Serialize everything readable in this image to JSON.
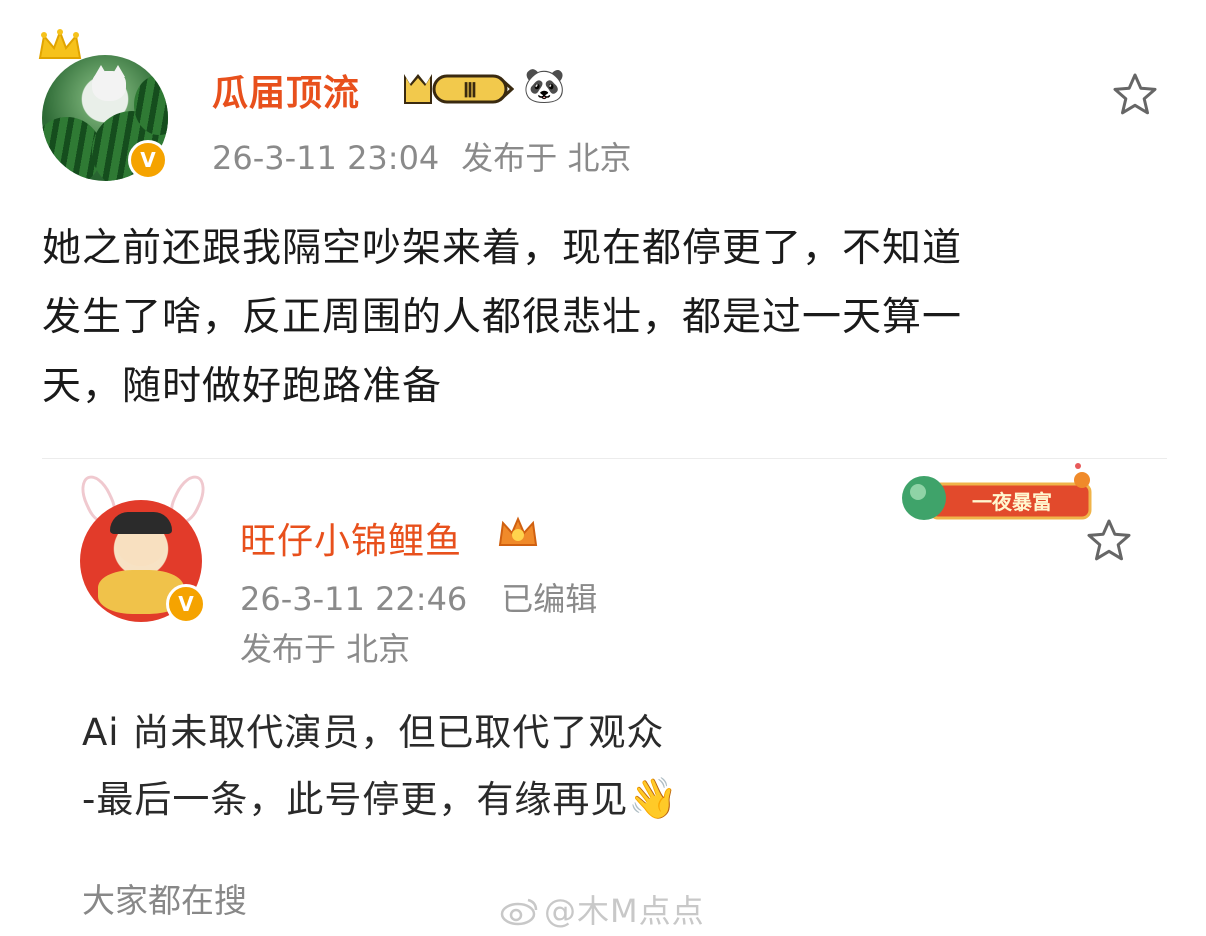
{
  "post": {
    "username": "瓜届顶流",
    "level_badge": "Ⅲ",
    "panda_emoji": "🐼",
    "timestamp": "26-3-11 23:04",
    "location": "发布于 北京",
    "text_line1": "她之前还跟我隔空吵架来着，现在都停更了，不知道",
    "text_line2": "发生了啥，反正周围的人都很悲壮，都是过一天算一",
    "text_line3": "天，随时做好跑路准备",
    "verify_badge": "V",
    "star_icon": "star-outline"
  },
  "quoted": {
    "username": "旺仔小锦鲤鱼",
    "timestamp": "26-3-11 22:46",
    "edited": "已编辑",
    "location": "发布于 北京",
    "banner_text": "一夜暴富",
    "verify_badge": "V",
    "text_line1": "Ai 尚未取代演员，但已取代了观众",
    "text_line2": "-最后一条，此号停更，有缘再见",
    "wave_emoji": "👋"
  },
  "footer": {
    "search_label": "大家都在搜"
  },
  "watermark": "@木M点点",
  "colors": {
    "accent": "#e8501c",
    "meta_gray": "#8a8a8a",
    "verify_orange": "#f5a300"
  }
}
